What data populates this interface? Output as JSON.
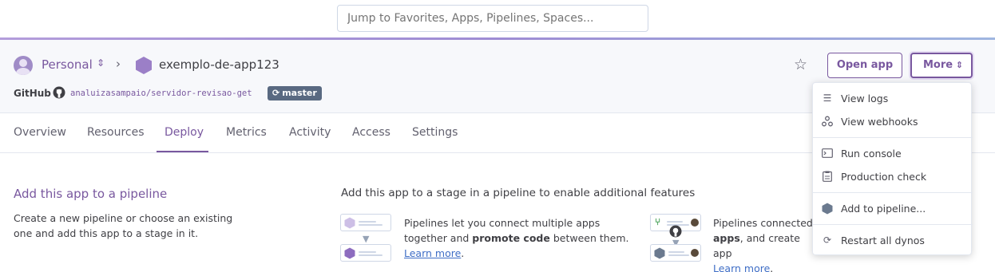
{
  "search": {
    "placeholder": "Jump to Favorites, Apps, Pipelines, Spaces..."
  },
  "header": {
    "account": "Personal",
    "app_name": "exemplo-de-app123",
    "github_label": "GitHub",
    "repo": "analuizasampaio/servidor-revisao-get",
    "branch": "master",
    "open_app_label": "Open app",
    "more_label": "More"
  },
  "tabs": [
    {
      "label": "Overview"
    },
    {
      "label": "Resources"
    },
    {
      "label": "Deploy",
      "active": true
    },
    {
      "label": "Metrics"
    },
    {
      "label": "Activity"
    },
    {
      "label": "Access"
    },
    {
      "label": "Settings"
    }
  ],
  "pipeline_section": {
    "title": "Add this app to a pipeline",
    "description": "Create a new pipeline or choose an existing one and add this app to a stage in it.",
    "stage_title": "Add this app to a stage in a pipeline to enable additional features",
    "feature1": {
      "text_a": "Pipelines let you connect multiple apps together and ",
      "text_bold": "promote code",
      "text_b": " between them.",
      "link": "Learn more",
      "suffix": "."
    },
    "feature2": {
      "text_a": "Pipelines connected",
      "text_bold": "apps",
      "text_b": ", and create app",
      "link": "Learn more",
      "suffix": "."
    }
  },
  "more_menu": {
    "items": [
      {
        "label": "View logs",
        "icon": "list-icon"
      },
      {
        "label": "View webhooks",
        "icon": "webhooks-icon"
      },
      {
        "label": "Run console",
        "icon": "console-icon"
      },
      {
        "label": "Production check",
        "icon": "clipboard-icon"
      },
      {
        "label": "Add to pipeline...",
        "icon": "pipeline-hex-icon"
      },
      {
        "label": "Restart all dynos",
        "icon": "restart-icon"
      }
    ]
  },
  "colors": {
    "accent": "#79589f",
    "link": "#3f6ec6",
    "branch_bg": "#596981",
    "text": "#3f3f44"
  }
}
